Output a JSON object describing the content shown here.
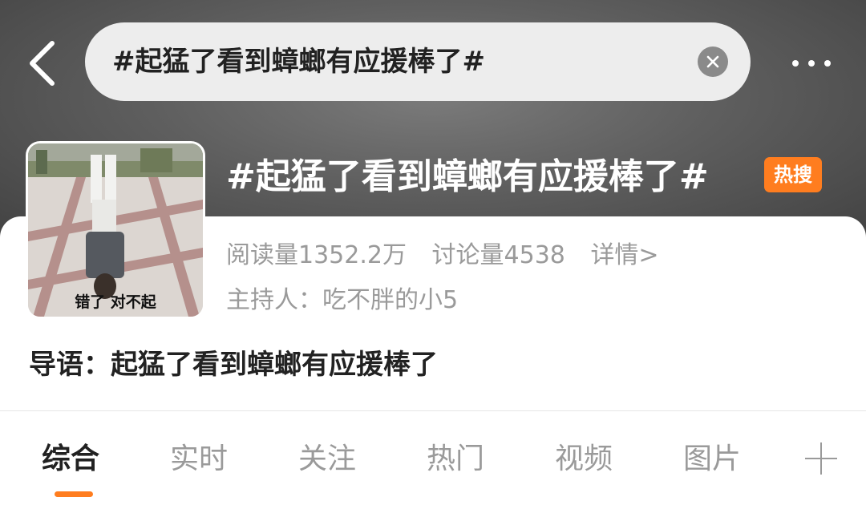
{
  "search": {
    "query": "#起猛了看到蟑螂有应援棒了#"
  },
  "topic": {
    "title": "#起猛了看到蟑螂有应援棒了#",
    "badge": "热搜",
    "reads": "阅读量1352.2万",
    "discussions": "讨论量4538",
    "details_link": "详情>",
    "host": "主持人：吃不胖的小5",
    "intro": "导语：起猛了看到蟑螂有应援棒了",
    "cover_caption": "错了 对不起"
  },
  "tabs": [
    {
      "label": "综合",
      "active": true
    },
    {
      "label": "实时",
      "active": false
    },
    {
      "label": "关注",
      "active": false
    },
    {
      "label": "热门",
      "active": false
    },
    {
      "label": "视频",
      "active": false
    },
    {
      "label": "图片",
      "active": false
    }
  ],
  "icons": {
    "back": "chevron-left-icon",
    "clear": "clear-icon",
    "more": "more-horizontal-icon",
    "add_tab": "plus-icon"
  },
  "colors": {
    "accent": "#ff7d1f",
    "header_bg": "#5f5f5f",
    "muted_text": "#9a9a9a",
    "primary_text": "#222222"
  }
}
